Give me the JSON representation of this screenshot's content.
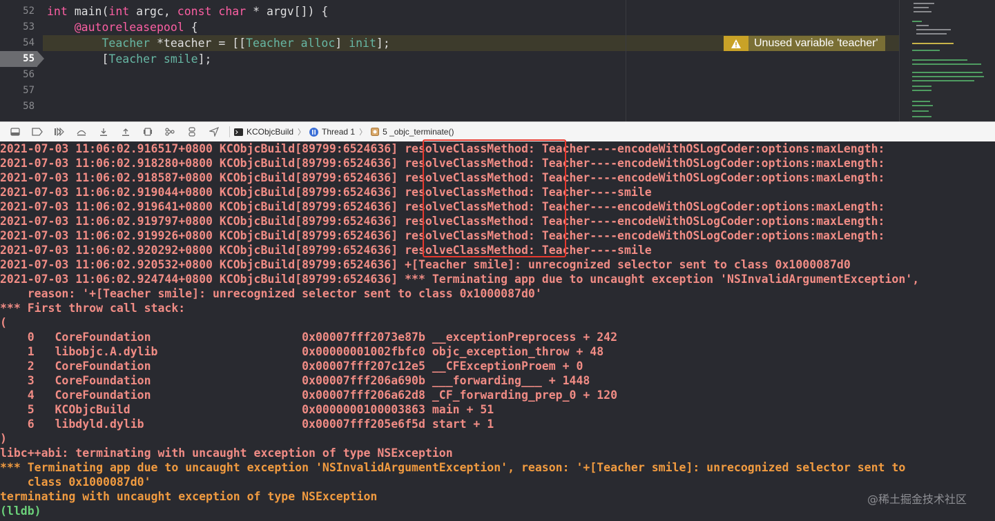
{
  "editor": {
    "lines": [
      {
        "num": "52",
        "parts": [
          {
            "t": "int",
            "c": "kw"
          },
          {
            "t": " main(",
            "c": ""
          },
          {
            "t": "int",
            "c": "kw"
          },
          {
            "t": " argc, ",
            "c": ""
          },
          {
            "t": "const",
            "c": "kw"
          },
          {
            "t": " ",
            "c": ""
          },
          {
            "t": "char",
            "c": "kw"
          },
          {
            "t": " * argv[]) {",
            "c": ""
          }
        ]
      },
      {
        "num": "53",
        "parts": [
          {
            "t": "    ",
            "c": ""
          },
          {
            "t": "@autoreleasepool",
            "c": "kw"
          },
          {
            "t": " {",
            "c": ""
          }
        ]
      },
      {
        "num": "54",
        "parts": [
          {
            "t": "        ",
            "c": ""
          },
          {
            "t": "Teacher",
            "c": "cls2"
          },
          {
            "t": " *teacher = [[",
            "c": ""
          },
          {
            "t": "Teacher",
            "c": "cls2"
          },
          {
            "t": " ",
            "c": ""
          },
          {
            "t": "alloc",
            "c": "mt"
          },
          {
            "t": "] ",
            "c": ""
          },
          {
            "t": "init",
            "c": "mt"
          },
          {
            "t": "];",
            "c": ""
          }
        ]
      },
      {
        "num": "55",
        "parts": [
          {
            "t": "        [",
            "c": ""
          },
          {
            "t": "Teacher",
            "c": "cls2"
          },
          {
            "t": " ",
            "c": ""
          },
          {
            "t": "smile",
            "c": "mt"
          },
          {
            "t": "];",
            "c": ""
          }
        ]
      },
      {
        "num": "56",
        "parts": []
      },
      {
        "num": "57",
        "parts": []
      },
      {
        "num": "58",
        "parts": []
      }
    ],
    "warning": "Unused variable 'teacher'"
  },
  "debugbar": {
    "target": "KCObjcBuild",
    "thread": "Thread 1",
    "frame": "5 _objc_terminate()"
  },
  "console": {
    "lines": [
      {
        "text": "2021-07-03 11:06:02.916517+0800 KCObjcBuild[89799:6524636] resolveClassMethod: Teacher----encodeWithOSLogCoder:options:maxLength:",
        "c": ""
      },
      {
        "text": "2021-07-03 11:06:02.918280+0800 KCObjcBuild[89799:6524636] resolveClassMethod: Teacher----encodeWithOSLogCoder:options:maxLength:",
        "c": ""
      },
      {
        "text": "2021-07-03 11:06:02.918587+0800 KCObjcBuild[89799:6524636] resolveClassMethod: Teacher----encodeWithOSLogCoder:options:maxLength:",
        "c": ""
      },
      {
        "text": "2021-07-03 11:06:02.919044+0800 KCObjcBuild[89799:6524636] resolveClassMethod: Teacher----smile",
        "c": ""
      },
      {
        "text": "2021-07-03 11:06:02.919641+0800 KCObjcBuild[89799:6524636] resolveClassMethod: Teacher----encodeWithOSLogCoder:options:maxLength:",
        "c": ""
      },
      {
        "text": "2021-07-03 11:06:02.919797+0800 KCObjcBuild[89799:6524636] resolveClassMethod: Teacher----encodeWithOSLogCoder:options:maxLength:",
        "c": ""
      },
      {
        "text": "2021-07-03 11:06:02.919926+0800 KCObjcBuild[89799:6524636] resolveClassMethod: Teacher----encodeWithOSLogCoder:options:maxLength:",
        "c": ""
      },
      {
        "text": "2021-07-03 11:06:02.920292+0800 KCObjcBuild[89799:6524636] resolveClassMethod: Teacher----smile",
        "c": ""
      },
      {
        "text": "2021-07-03 11:06:02.920532+0800 KCObjcBuild[89799:6524636] +[Teacher smile]: unrecognized selector sent to class 0x1000087d0",
        "c": ""
      },
      {
        "text": "2021-07-03 11:06:02.924744+0800 KCObjcBuild[89799:6524636] *** Terminating app due to uncaught exception 'NSInvalidArgumentException',",
        "c": ""
      },
      {
        "text": "    reason: '+[Teacher smile]: unrecognized selector sent to class 0x1000087d0'",
        "c": ""
      },
      {
        "text": "*** First throw call stack:",
        "c": ""
      },
      {
        "text": "(",
        "c": ""
      },
      {
        "text": "    0   CoreFoundation                      0x00007fff2073e87b __exceptionPreprocess + 242",
        "c": ""
      },
      {
        "text": "    1   libobjc.A.dylib                     0x00000001002fbfc0 objc_exception_throw + 48",
        "c": ""
      },
      {
        "text": "    2   CoreFoundation                      0x00007fff207c12e5 __CFExceptionProem + 0",
        "c": ""
      },
      {
        "text": "    3   CoreFoundation                      0x00007fff206a690b ___forwarding___ + 1448",
        "c": ""
      },
      {
        "text": "    4   CoreFoundation                      0x00007fff206a62d8 _CF_forwarding_prep_0 + 120",
        "c": ""
      },
      {
        "text": "    5   KCObjcBuild                         0x0000000100003863 main + 51",
        "c": ""
      },
      {
        "text": "    6   libdyld.dylib                       0x00007fff205e6f5d start + 1",
        "c": ""
      },
      {
        "text": ")",
        "c": ""
      },
      {
        "text": "libc++abi: terminating with uncaught exception of type NSException",
        "c": ""
      },
      {
        "text": "*** Terminating app due to uncaught exception 'NSInvalidArgumentException', reason: '+[Teacher smile]: unrecognized selector sent to",
        "c": "orange"
      },
      {
        "text": "    class 0x1000087d0'",
        "c": "orange"
      },
      {
        "text": "terminating with uncaught exception of type NSException",
        "c": "orange"
      },
      {
        "text": "(lldb)",
        "c": "green"
      }
    ],
    "watermark": "@稀土掘金技术社区"
  }
}
